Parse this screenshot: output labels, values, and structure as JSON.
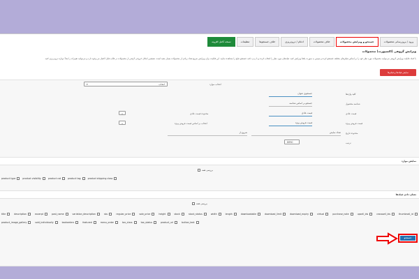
{
  "tabs": [
    {
      "label": "ورود / بروزرسانی محصولات",
      "active": false,
      "green": false
    },
    {
      "label": "جستجو و ویرایش محصولات",
      "active": true,
      "green": false
    },
    {
      "label": "خلاف محصولات",
      "active": false,
      "green": false
    },
    {
      "label": "ادغام / درون‌ریزی",
      "active": false,
      "green": false
    },
    {
      "label": "خلاف جستجوها",
      "active": false,
      "green": false
    },
    {
      "label": "تنظیمات",
      "active": false,
      "green": false
    },
    {
      "label": "نسخه کامل افزونه",
      "active": false,
      "green": true
    }
  ],
  "section_title": "ویرایش گروهی (اکسپورت) محصولات",
  "description": "با کمک قابلیت ویرایش گروهی می‌توانید محصولات مورد نظر خود را بر اساس فیلترهای مختلف جستجو کرده و سپس به صورت یکجا ویرایش کنید. فیلدهای مورد نظر را انتخاب کرده و با زدن دکمه جستجو نتایج را مشاهده نمایید. این قابلیت برای ویرایش سریع تعداد زیادی از محصولات بسیار مفید است. همچنین امکان خروجی گرفتن از محصولات در قالب فایل اکسل نیز وجود دارد و می‌توانید تغییرات را بعداً دوباره درون‌ریزی کنید.",
  "red_button": "نمایش فیلدها و فیلترها",
  "filters": {
    "attributes_label": "انتخاب موارد",
    "attributes_select": "انتخاب",
    "tags_label": "کلید واژه‌ها",
    "tags_placeholder": "جستجوی عنوان",
    "sku_label": "شناسه محصول",
    "sku_placeholder": "جستجو بر اساس شناسه",
    "price_label": "قیمت عادی",
    "price_placeholder": "قیمت عادی",
    "price_right_label": "محدوده قیمت عادی",
    "price_op": "<",
    "sale_label": "قیمت فروش ویژه",
    "sale_placeholder": "قیمت فروش ویژه",
    "sale_right_label": "انتخاب بر اساس قیمت فروش ویژه",
    "sale_op": ">",
    "date_label": "محدوده تاریخ",
    "date_from_placeholder": "شروع از",
    "date_to_placeholder": "تعداد نمایش",
    "order_label": "ترتیب",
    "order_value": "DESC"
  },
  "type_section": {
    "title": "نمایش موارد",
    "select_all": "بررسی همه",
    "fields": [
      "product type",
      "product visibility",
      "product cat",
      "product tag",
      "product shipping class"
    ]
  },
  "columns_section": {
    "title": "نشان دادن فیلدها",
    "select_all": "بررسی همه",
    "fields": [
      "title",
      "description",
      "excerpt",
      "post_name",
      "variation_description",
      "sku",
      "regular_price",
      "sale_price",
      "height",
      "stock",
      "stock_status",
      "width",
      "length",
      "downloadable",
      "download_limit",
      "download_expiry",
      "virtual",
      "purchase_note",
      "upsell_ids",
      "crosssell_ids",
      "thumbnail_id",
      "product_image_gallery",
      "sold_individually",
      "backorders",
      "featured",
      "menu_order",
      "tax_class",
      "tax_status",
      "product_url",
      "button_text"
    ]
  },
  "search_button": "جستجو"
}
